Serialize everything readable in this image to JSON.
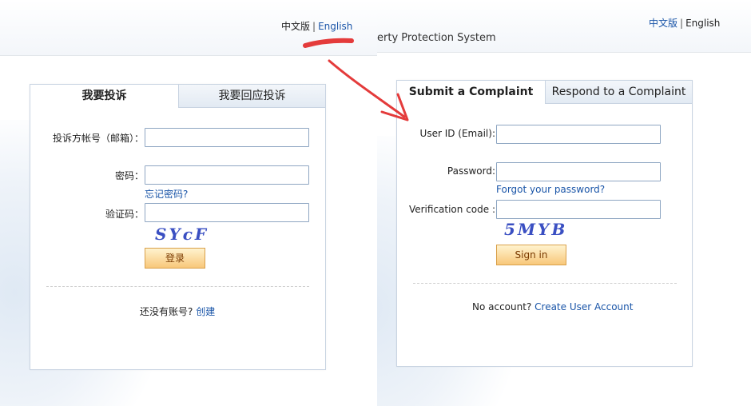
{
  "left": {
    "lang_current": "中文版",
    "lang_separator": "|",
    "lang_other": "English",
    "tabs": [
      "我要投诉",
      "我要回应投诉"
    ],
    "user_label": "投诉方帐号（邮箱）：",
    "password_label": "密码：",
    "forgot": "忘记密码?",
    "captcha_label": "验证码：",
    "captcha_text": "SYcF",
    "login_button": "登录",
    "no_account": "还没有账号?",
    "create_link": "创建"
  },
  "right": {
    "lang_current": "中文版",
    "lang_separator": "|",
    "lang_other": "English",
    "system_title": "erty Protection System",
    "tabs": [
      "Submit a Complaint",
      "Respond to a Complaint"
    ],
    "user_label": "User ID (Email):",
    "password_label": "Password:",
    "forgot": "Forgot your password?",
    "captcha_label": "Verification code :",
    "captcha_text": "5MYB",
    "login_button": "Sign in",
    "no_account": "No account?",
    "create_link": "Create User Account"
  },
  "colors": {
    "link": "#1a55a8",
    "accent_arrow": "#e43b3b",
    "button_border": "#d9a04a"
  }
}
